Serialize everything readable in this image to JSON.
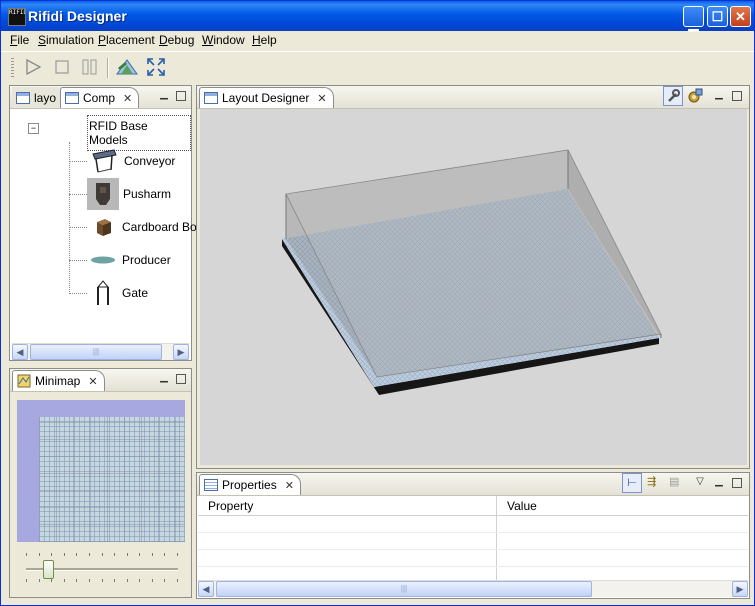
{
  "window": {
    "title": "Rifidi Designer",
    "icon_text": "RIFIDI",
    "controls": [
      "minimize",
      "maximize",
      "close"
    ]
  },
  "menubar": {
    "items": [
      {
        "label": "File",
        "mnemonic": "F",
        "rest": "ile"
      },
      {
        "label": "Simulation",
        "mnemonic": "S",
        "rest": "imulation"
      },
      {
        "label": "Placement",
        "mnemonic": "P",
        "rest": "lacement"
      },
      {
        "label": "Debug",
        "mnemonic": "D",
        "rest": "ebug"
      },
      {
        "label": "Window",
        "mnemonic": "W",
        "rest": "indow"
      },
      {
        "label": "Help",
        "mnemonic": "H",
        "rest": "elp"
      }
    ]
  },
  "toolbar": {
    "buttons": [
      "play-icon",
      "stop-icon",
      "pause-icon",
      "camera-view-icon",
      "fit-to-screen-icon"
    ]
  },
  "components_view": {
    "tabs": [
      {
        "label": "layo",
        "active": false
      },
      {
        "label": "Comp",
        "active": true
      }
    ],
    "tree": {
      "root": {
        "label": "RFID Base Models",
        "expander": "−"
      },
      "items": [
        {
          "label": "Conveyor",
          "icon": "conveyor-icon"
        },
        {
          "label": "Pusharm",
          "icon": "pusharm-icon"
        },
        {
          "label": "Cardboard Box",
          "icon": "cardboard-box-icon"
        },
        {
          "label": "Producer",
          "icon": "producer-icon"
        },
        {
          "label": "Gate",
          "icon": "gate-icon"
        }
      ]
    }
  },
  "minimap_view": {
    "tab_label": "Minimap",
    "zoom_slider_value": 0.12
  },
  "layout_view": {
    "tab_label": "Layout Designer"
  },
  "properties_view": {
    "tab_label": "Properties",
    "columns": [
      "Property",
      "Value"
    ],
    "rows": [
      [
        "",
        ""
      ],
      [
        "",
        ""
      ],
      [
        "",
        ""
      ],
      [
        "",
        ""
      ]
    ]
  },
  "colors": {
    "titlebar": "#0054e3",
    "workspace": "#ece9d8",
    "canvas": "#d6d6d6",
    "floor": "#9ab8d6",
    "minimap_bg": "#a8a8e0"
  }
}
